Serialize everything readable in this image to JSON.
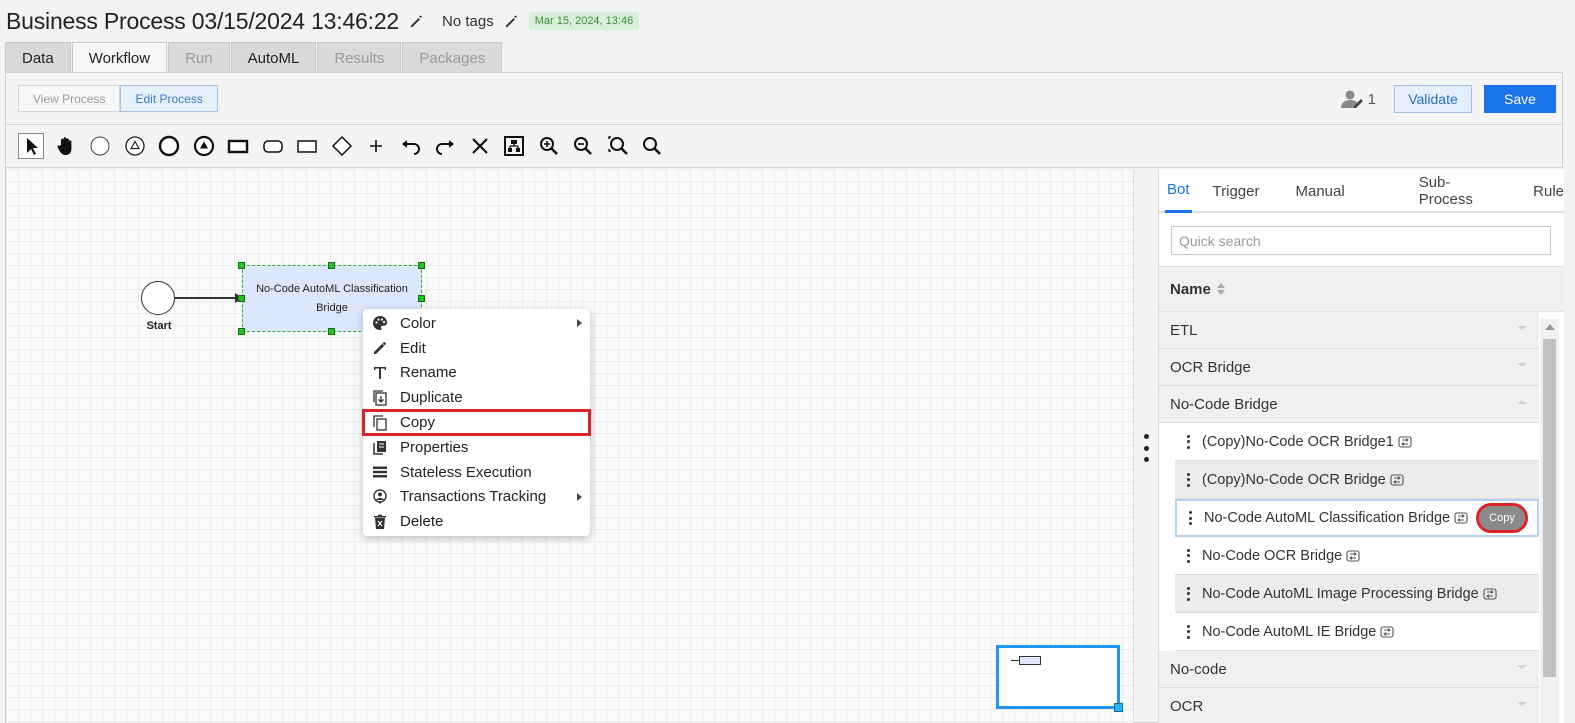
{
  "header": {
    "title": "Business Process 03/15/2024 13:46:22",
    "tags_label": "No tags",
    "date_badge": "Mar 15, 2024, 13:46"
  },
  "tabs": [
    {
      "label": "Data",
      "state": "normal"
    },
    {
      "label": "Workflow",
      "state": "active"
    },
    {
      "label": "Run",
      "state": "disabled"
    },
    {
      "label": "AutoML",
      "state": "normal"
    },
    {
      "label": "Results",
      "state": "disabled"
    },
    {
      "label": "Packages",
      "state": "disabled"
    }
  ],
  "actions": {
    "view_process": "View Process",
    "edit_process": "Edit Process",
    "user_count": "1",
    "validate": "Validate",
    "save": "Save"
  },
  "toolbar_icons": [
    "pointer-icon",
    "hand-icon",
    "start-event-icon",
    "signal-start-icon",
    "end-event-icon",
    "signal-end-icon",
    "task-icon",
    "subprocess-icon",
    "annotation-icon",
    "gateway-icon",
    "add-icon",
    "undo-icon",
    "redo-icon",
    "delete-icon",
    "layout-icon",
    "zoom-in-icon",
    "zoom-out-icon",
    "zoom-fit-icon",
    "zoom-reset-icon"
  ],
  "canvas": {
    "start_label": "Start",
    "task_label": "No-Code AutoML Classification Bridge"
  },
  "context_menu": {
    "items": [
      {
        "label": "Color",
        "icon": "palette-icon",
        "submenu": true
      },
      {
        "label": "Edit",
        "icon": "pencil-icon",
        "submenu": false
      },
      {
        "label": "Rename",
        "icon": "text-icon",
        "submenu": false
      },
      {
        "label": "Duplicate",
        "icon": "duplicate-icon",
        "submenu": false
      },
      {
        "label": "Copy",
        "icon": "copy-icon",
        "submenu": false,
        "highlighted": true
      },
      {
        "label": "Properties",
        "icon": "properties-icon",
        "submenu": false
      },
      {
        "label": "Stateless Execution",
        "icon": "list-icon",
        "submenu": false
      },
      {
        "label": "Transactions Tracking",
        "icon": "tracking-icon",
        "submenu": true
      },
      {
        "label": "Delete",
        "icon": "trash-icon",
        "submenu": false
      }
    ]
  },
  "right_panel": {
    "tabs": [
      "Bot",
      "Trigger",
      "Manual",
      "Sub-Process",
      "Rule"
    ],
    "active_tab": "Bot",
    "search_placeholder": "Quick search",
    "column_header": "Name",
    "groups": [
      {
        "label": "ETL",
        "expanded": false,
        "items": []
      },
      {
        "label": "OCR Bridge",
        "expanded": false,
        "items": []
      },
      {
        "label": "No-Code Bridge",
        "expanded": true,
        "items": [
          {
            "label": "(Copy)No-Code OCR Bridge1"
          },
          {
            "label": "(Copy)No-Code OCR Bridge"
          },
          {
            "label": "No-Code AutoML Classification Bridge",
            "selected": true,
            "action": "Copy"
          },
          {
            "label": "No-Code OCR Bridge"
          },
          {
            "label": "No-Code AutoML Image Processing Bridge"
          },
          {
            "label": "No-Code AutoML IE Bridge"
          }
        ]
      },
      {
        "label": "No-code",
        "expanded": false,
        "items": []
      },
      {
        "label": "OCR",
        "expanded": false,
        "items": []
      }
    ]
  },
  "colors": {
    "accent": "#1a73e8",
    "highlight": "#d8232a",
    "node_fill": "#dce7fb",
    "selection_handle": "#22c322",
    "date_badge_bg": "#d8f0d8"
  }
}
